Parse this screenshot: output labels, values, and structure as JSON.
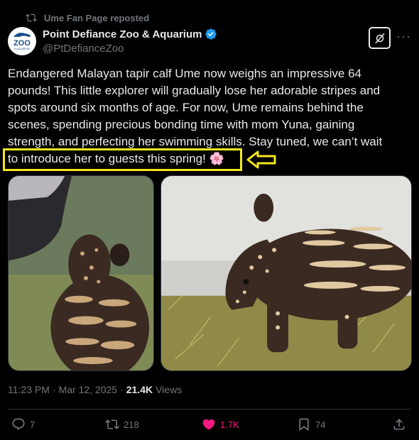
{
  "repost": {
    "label": "Ume Fan Page reposted",
    "icon": "repost-icon"
  },
  "author": {
    "name": "Point Defiance Zoo & Aquarium",
    "handle": "@PtDefianceZoo",
    "verified": true,
    "avatar_text_top": "POINT DEFIANCE",
    "avatar_text_main": "ZOO",
    "avatar_text_bottom": "& AQUARIUM"
  },
  "tweet": {
    "lines": [
      "Endangered Malayan tapir calf Ume now weighs an impressive 64",
      "pounds! This little explorer will gradually lose her adorable stripes and",
      "spots around six months of age. For now, Ume remains behind the",
      "scenes, spending precious bonding time with mom Yuna, gaining",
      "strength, and perfecting her swimming skills. Stay tuned, we can’t wait",
      "to introduce her to guests this spring! 🌸"
    ]
  },
  "meta": {
    "time": "11:23 PM",
    "separator": "·",
    "date": "Mar 12, 2025",
    "views_count": "21.4K",
    "views_label": "Views"
  },
  "actions": {
    "replies": "7",
    "reposts": "218",
    "likes": "1.7K",
    "bookmarks": "74"
  },
  "colors": {
    "background": "#000000",
    "text": "#e7e9ea",
    "muted": "#71767b",
    "like": "#f91880",
    "verified": "#1d9bf0",
    "annotation": "#f5e81a"
  }
}
